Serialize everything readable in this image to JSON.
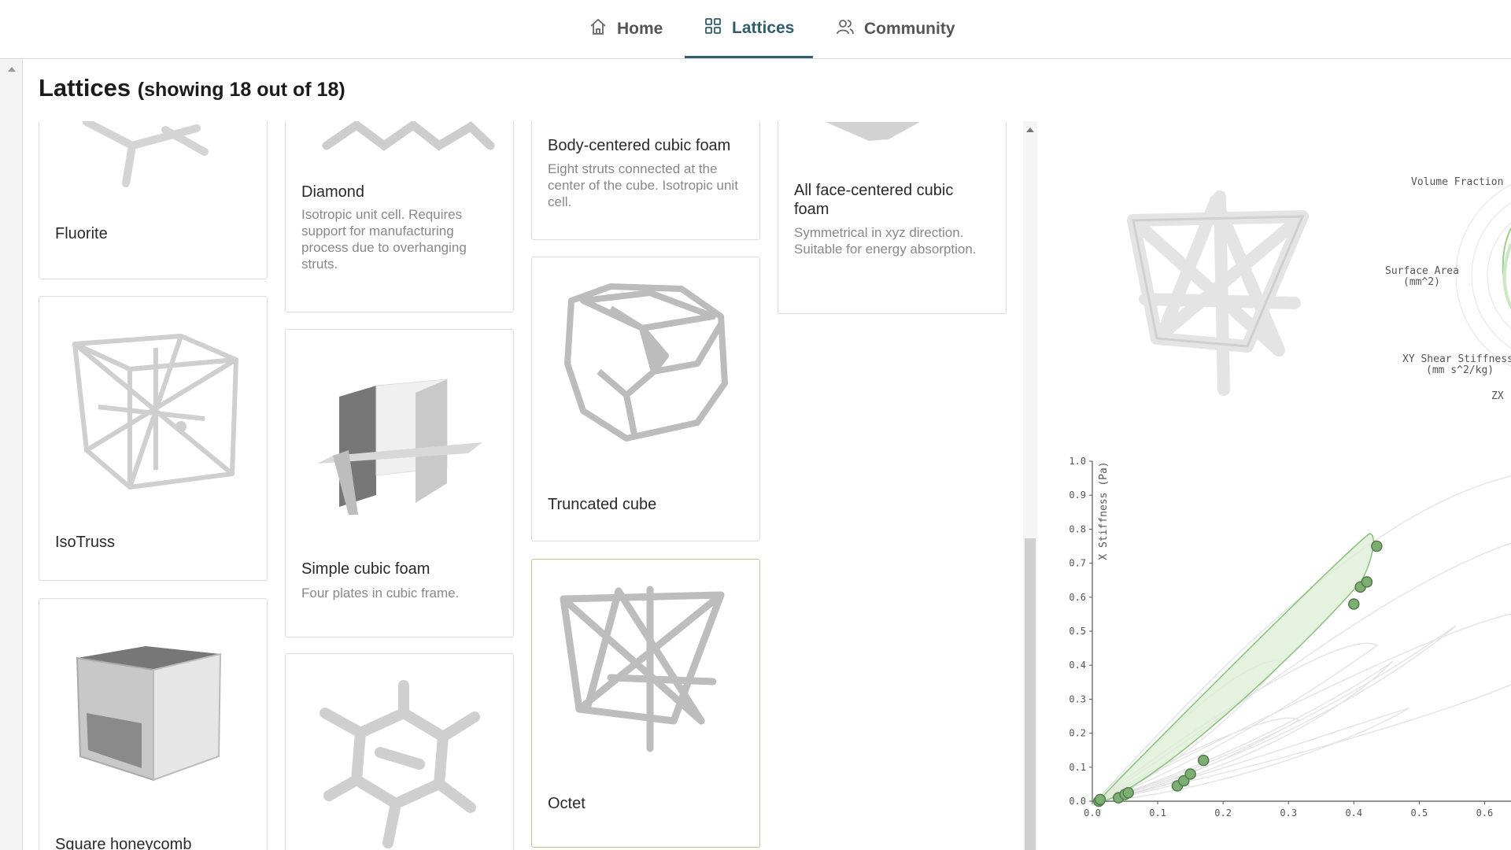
{
  "nav": {
    "items": [
      {
        "label": "Home",
        "icon": "home-icon"
      },
      {
        "label": "Lattices",
        "icon": "grid-icon",
        "active": true
      },
      {
        "label": "Community",
        "icon": "users-icon"
      }
    ],
    "accent": "#2f5e6a"
  },
  "page": {
    "title": "Lattices",
    "subtitle": "(showing 18 out of 18)"
  },
  "cards": {
    "fluorite": {
      "name": "Fluorite",
      "desc": ""
    },
    "diamond": {
      "name": "Diamond",
      "desc": "Isotropic unit cell. Requires support for manufacturing process due to overhanging struts."
    },
    "bcc_foam": {
      "name": "Body-centered cubic foam",
      "desc": "Eight struts connected at the center of the cube. Isotropic unit cell."
    },
    "afcc_foam": {
      "name": "All face-centered cubic foam",
      "desc": "Symmetrical in xyz direction. Suitable for energy absorption."
    },
    "isotruss": {
      "name": "IsoTruss",
      "desc": ""
    },
    "simple_cubic_foam": {
      "name": "Simple cubic foam",
      "desc": "Four plates in cubic frame."
    },
    "truncated_cube": {
      "name": "Truncated cube",
      "desc": ""
    },
    "octet": {
      "name": "Octet",
      "desc": "",
      "selected": true
    },
    "square_honeycomb": {
      "name": "Square honeycomb",
      "desc": ""
    },
    "unnamed_bottom": {
      "name": "",
      "desc": ""
    }
  },
  "radar": {
    "labels": {
      "volume_fraction": "Volume Fraction",
      "surface_area_1": "Surface Area",
      "surface_area_2": "(mm^2)",
      "xy_shear_1": "XY Shear Stiffness",
      "xy_shear_2": "(mm s^2/kg)",
      "zx": "ZX"
    }
  },
  "chart_data": {
    "type": "scatter",
    "title": "",
    "xlabel": "",
    "ylabel": "X Stiffness (Pa)",
    "xlim": [
      0,
      0.65
    ],
    "ylim": [
      0,
      1.0
    ],
    "x_ticks": [
      "0.0",
      "0.1",
      "0.2",
      "0.3",
      "0.4",
      "0.5",
      "0.6"
    ],
    "y_ticks": [
      "0.0",
      "0.1",
      "0.2",
      "0.3",
      "0.4",
      "0.5",
      "0.6",
      "0.7",
      "0.8",
      "0.9",
      "1.0"
    ],
    "grid": false,
    "series": [
      {
        "color": "#7fae74",
        "points": [
          [
            0.01,
            0.0
          ],
          [
            0.012,
            0.005
          ],
          [
            0.04,
            0.01
          ],
          [
            0.05,
            0.02
          ],
          [
            0.055,
            0.025
          ],
          [
            0.13,
            0.045
          ],
          [
            0.14,
            0.06
          ],
          [
            0.15,
            0.08
          ],
          [
            0.17,
            0.12
          ],
          [
            0.4,
            0.58
          ],
          [
            0.41,
            0.63
          ],
          [
            0.42,
            0.645
          ],
          [
            0.435,
            0.75
          ]
        ]
      }
    ]
  }
}
